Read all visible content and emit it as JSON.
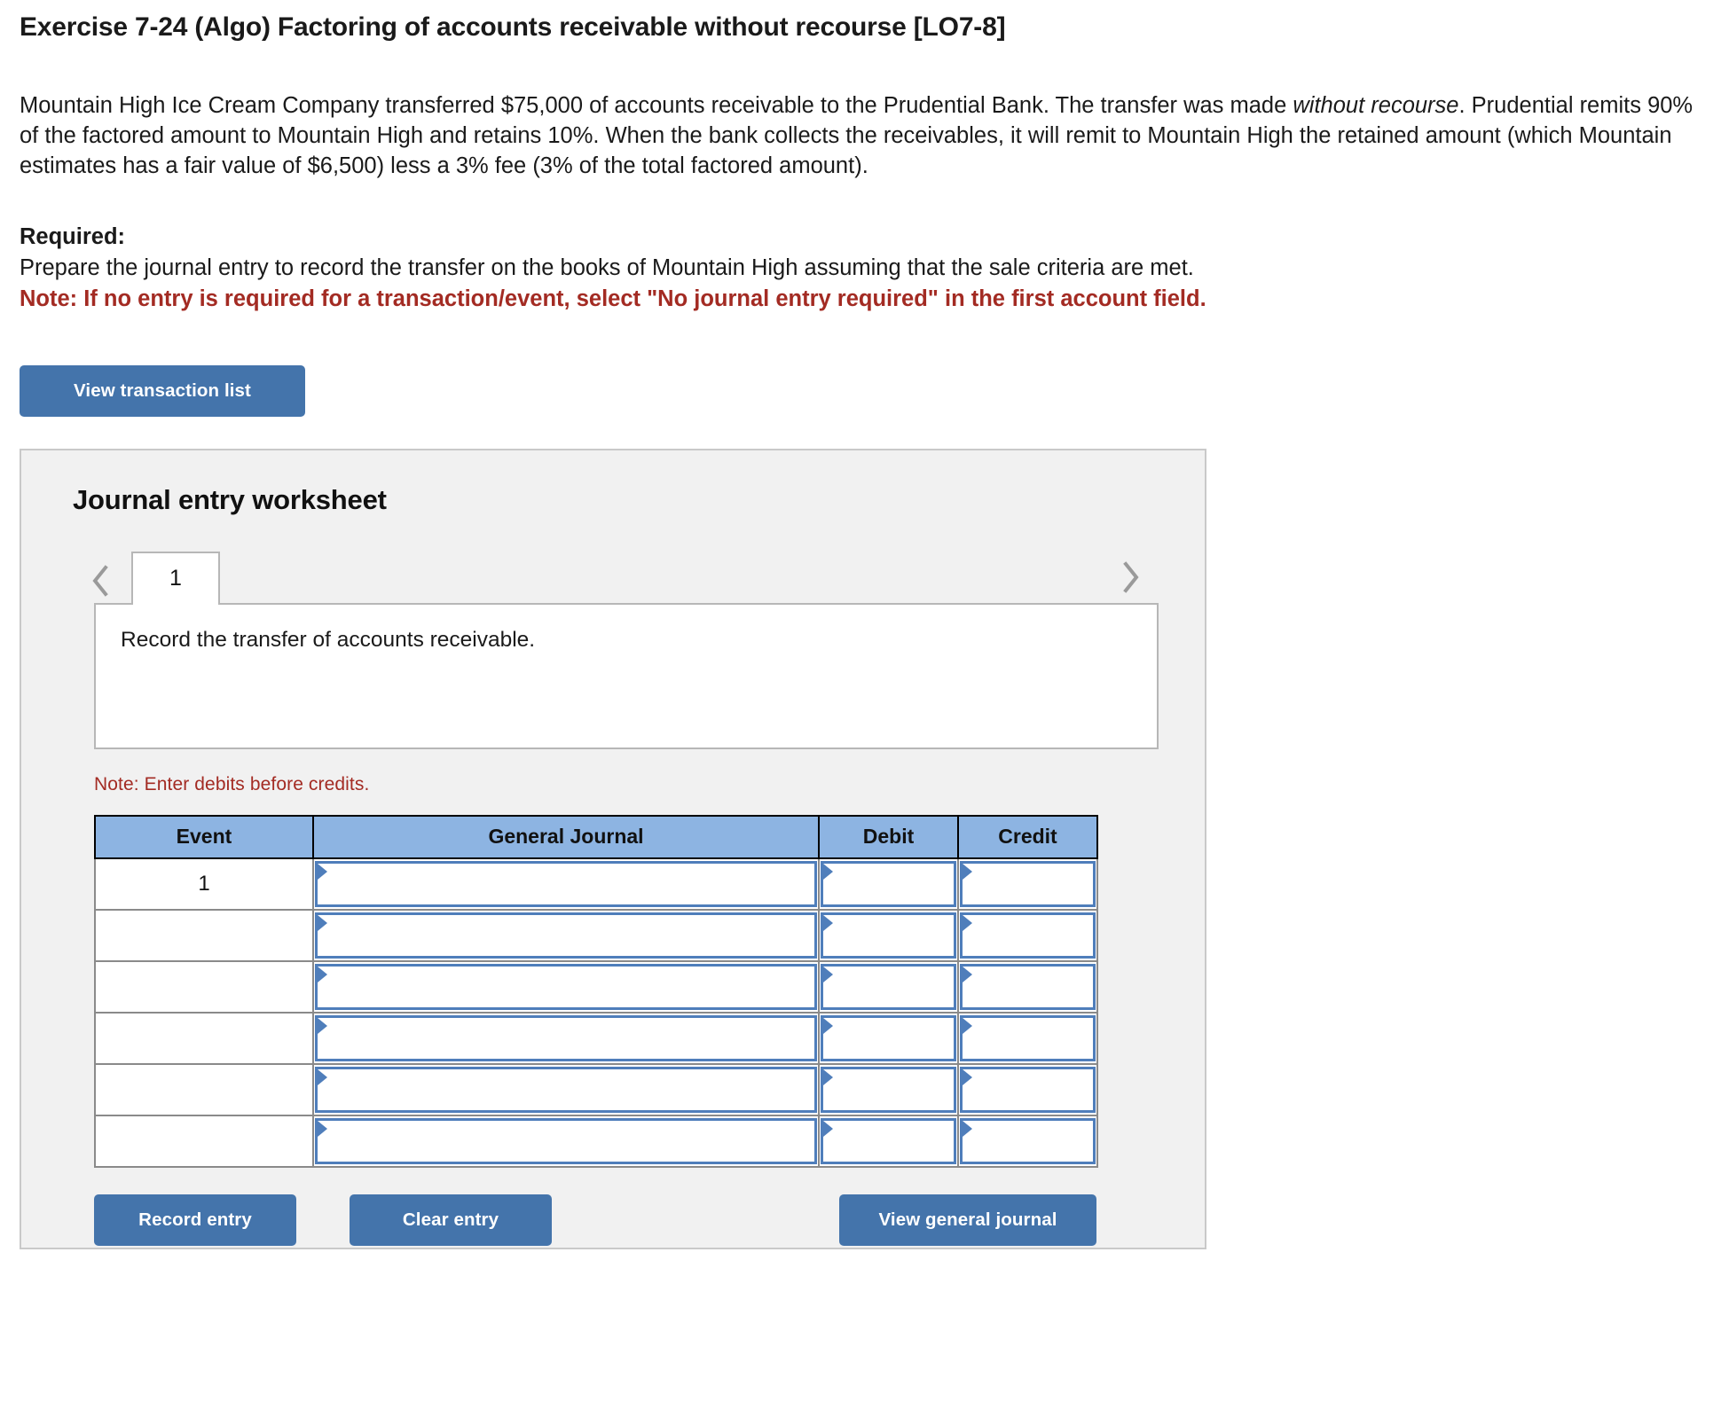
{
  "exercise": {
    "title": "Exercise 7-24 (Algo) Factoring of accounts receivable without recourse [LO7-8]",
    "problem_part1": "Mountain High Ice Cream Company transferred $75,000 of accounts receivable to the Prudential Bank. The transfer was made ",
    "problem_italic": "without recourse",
    "problem_part2": ". Prudential remits 90% of the factored amount to Mountain High and retains 10%. When the bank collects the receivables, it will remit to Mountain High the retained amount (which Mountain estimates has a fair value of $6,500) less a 3% fee (3% of the total factored amount)."
  },
  "required": {
    "label": "Required:",
    "instruction": "Prepare the journal entry to record the transfer on the books of Mountain High assuming that the sale criteria are met.",
    "note": "Note: If no entry is required for a transaction/event, select \"No journal entry required\" in the first account field."
  },
  "toolbar": {
    "view_transaction_list": "View transaction list"
  },
  "worksheet": {
    "title": "Journal entry worksheet",
    "prev_icon": "chevron-left-icon",
    "next_icon": "chevron-right-icon",
    "tabs": [
      {
        "label": "1",
        "active": true
      }
    ],
    "prompt": "Record the transfer of accounts receivable.",
    "debits_note": "Note: Enter debits before credits.",
    "table": {
      "headers": [
        "Event",
        "General Journal",
        "Debit",
        "Credit"
      ],
      "rows": [
        {
          "event": "1",
          "general_journal": "",
          "debit": "",
          "credit": ""
        },
        {
          "event": "",
          "general_journal": "",
          "debit": "",
          "credit": ""
        },
        {
          "event": "",
          "general_journal": "",
          "debit": "",
          "credit": ""
        },
        {
          "event": "",
          "general_journal": "",
          "debit": "",
          "credit": ""
        },
        {
          "event": "",
          "general_journal": "",
          "debit": "",
          "credit": ""
        },
        {
          "event": "",
          "general_journal": "",
          "debit": "",
          "credit": ""
        }
      ]
    },
    "buttons": {
      "record_entry": "Record entry",
      "clear_entry": "Clear entry",
      "view_general_journal": "View general journal"
    }
  },
  "colors": {
    "button_blue": "#4474ab",
    "header_blue": "#8db4e2",
    "field_border_blue": "#4f7ebb",
    "note_red": "#a32b23",
    "panel_bg": "#f1f1f1",
    "panel_border": "#c9c9c9"
  }
}
